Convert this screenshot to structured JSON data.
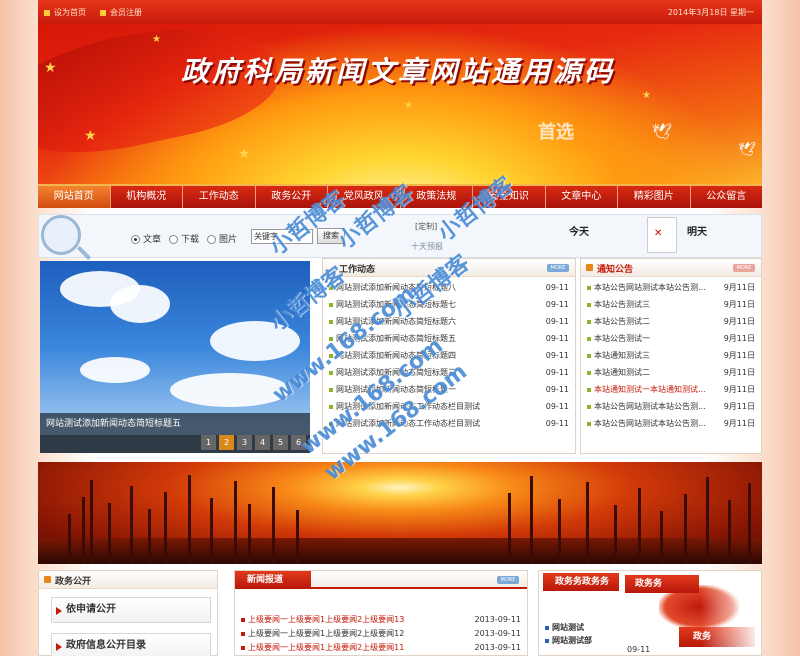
{
  "topbar": {
    "set_home": "设为首页",
    "register": "会员注册",
    "date": "2014年3月18日  星期一"
  },
  "banner": {
    "title": "政府科局新闻文章网站通用源码",
    "logo_text": "首选"
  },
  "nav": {
    "items": [
      "网站首页",
      "机构概况",
      "工作动态",
      "政务公开",
      "党风政风",
      "政策法规",
      "安全知识",
      "文章中心",
      "精彩图片",
      "公众留言"
    ],
    "active_index": 0
  },
  "search": {
    "options": [
      "文章",
      "下载",
      "图片"
    ],
    "selected": "文章",
    "keyword_value": "关键字",
    "button": "搜索",
    "custom": "[定制]",
    "ten_days": "十天预报",
    "today": "今天",
    "tomorrow": "明天"
  },
  "slideshow": {
    "caption": "网站测试添加新闻动态简短标题五",
    "pages": [
      "1",
      "2",
      "3",
      "4",
      "5",
      "6"
    ],
    "current_page": 2
  },
  "work_news": {
    "title": "工作动态",
    "more": "MORE",
    "items": [
      {
        "title": "网站测试添加新闻动态简短标题八",
        "date": "09-11"
      },
      {
        "title": "网站测试添加新闻动态简短标题七",
        "date": "09-11"
      },
      {
        "title": "网站测试添加新闻动态简短标题六",
        "date": "09-11"
      },
      {
        "title": "网站测试添加新闻动态简短标题五",
        "date": "09-11"
      },
      {
        "title": "网站测试添加新闻动态简短标题四",
        "date": "09-11"
      },
      {
        "title": "网站测试添加新闻动态简短标题三",
        "date": "09-11"
      },
      {
        "title": "网站测试添加新闻动态简短标题一",
        "date": "09-11"
      },
      {
        "title": "网站测试添加新闻动态工作动态栏目测试",
        "date": "09-11"
      },
      {
        "title": "网站测试添加新闻动态工作动态栏目测试",
        "date": "09-11"
      }
    ]
  },
  "notice": {
    "title": "通知公告",
    "more": "MORE",
    "items": [
      {
        "title": "本站公告网站测试本站公告测…",
        "date": "9月11日",
        "highlight": false
      },
      {
        "title": "本站公告测试三",
        "date": "9月11日",
        "highlight": false
      },
      {
        "title": "本站公告测试二",
        "date": "9月11日",
        "highlight": false
      },
      {
        "title": "本站公告测试一",
        "date": "9月11日",
        "highlight": false
      },
      {
        "title": "本站通知测试三",
        "date": "9月11日",
        "highlight": false
      },
      {
        "title": "本站通知测试二",
        "date": "9月11日",
        "highlight": false
      },
      {
        "title": "本站通知测试一本站通知测试…",
        "date": "9月11日",
        "highlight": true
      },
      {
        "title": "本站公告网站测试本站公告测…",
        "date": "9月11日",
        "highlight": false
      },
      {
        "title": "本站公告网站测试本站公告测…",
        "date": "9月11日",
        "highlight": false
      }
    ]
  },
  "gov_open": {
    "title": "政务公开",
    "buttons": [
      "依申请公开",
      "政府信息公开目录"
    ]
  },
  "news_report": {
    "title": "新闻报道",
    "more": "MORE",
    "items": [
      {
        "title": "上级要闻一上级要闻1上级要闻2上级要闻13",
        "date": "2013-09-11",
        "red": true
      },
      {
        "title": "上级要闻一上级要闻1上级要闻2上级要闻12",
        "date": "2013-09-11",
        "red": false
      },
      {
        "title": "上级要闻一上级要闻1上级要闻2上级要闻11",
        "date": "2013-09-11",
        "red": true
      }
    ]
  },
  "gov_affairs": {
    "tab1": "政务务政务务",
    "tab2": "政务务",
    "tab3": "政务",
    "items": [
      "网站测试",
      "网站测试部"
    ],
    "date": "09-11"
  },
  "watermarks": [
    "小哲博客",
    "小哲博客",
    "小哲博客",
    "小哲博客",
    "小哲博客",
    "www.168.com",
    "www.168.com",
    "www.168.com"
  ]
}
